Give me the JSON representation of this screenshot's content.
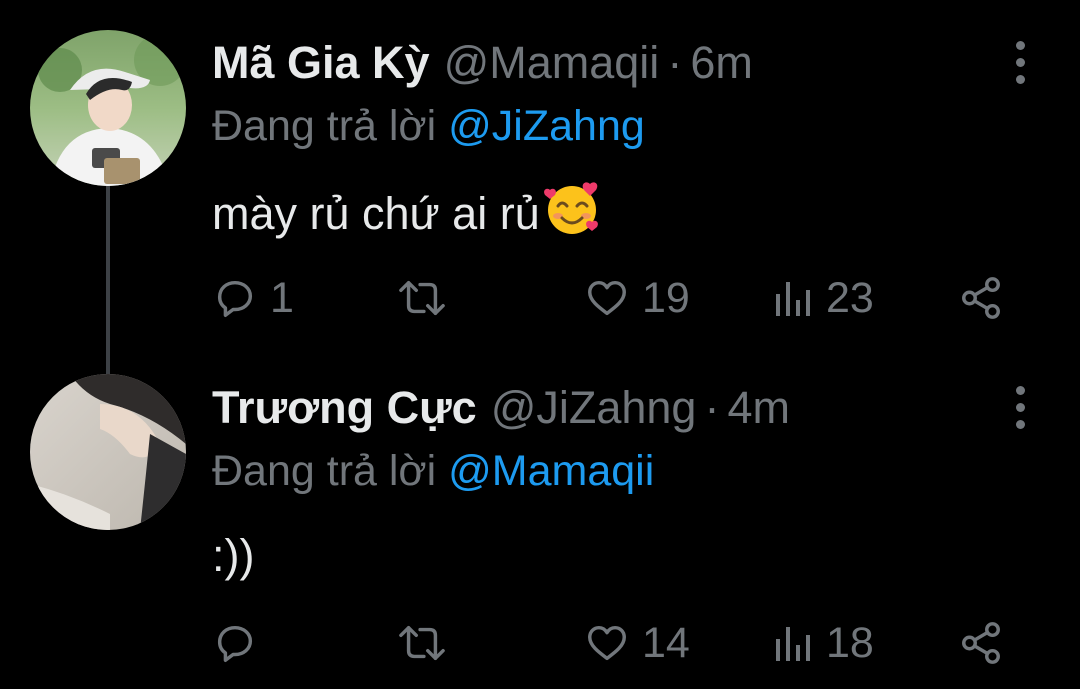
{
  "tweets": [
    {
      "display_name": "Mã Gia Kỳ",
      "handle": "@Mamaqii",
      "separator": "·",
      "time": "6m",
      "reply_prefix": "Đang trả lời",
      "reply_to": "@JiZahng",
      "text": "mày rủ chứ ai rủ",
      "emoji": "smiling-face-with-hearts",
      "replies": "1",
      "retweets": "",
      "likes": "19",
      "views": "23"
    },
    {
      "display_name": "Trương Cực",
      "handle": "@JiZahng",
      "separator": "·",
      "time": "4m",
      "reply_prefix": "Đang trả lời",
      "reply_to": "@Mamaqii",
      "text": ":))",
      "replies": "",
      "retweets": "",
      "likes": "14",
      "views": "18"
    }
  ],
  "icons": {
    "reply": "comment-bubble-icon",
    "retweet": "retweet-arrows-icon",
    "like": "heart-outline-icon",
    "views": "bar-chart-icon",
    "share": "share-nodes-icon",
    "more": "vertical-ellipsis-icon"
  },
  "colors": {
    "background": "#000000",
    "text": "#e7e9ea",
    "muted": "#71767b",
    "mention": "#1d9bf0",
    "thread_line": "#3d4146"
  }
}
